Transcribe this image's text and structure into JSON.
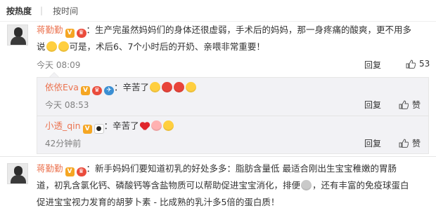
{
  "sort": {
    "hot": "按热度",
    "time": "按时间",
    "divider": "|"
  },
  "comments": [
    {
      "username": "蒋勤勤",
      "text_part1": "：生产完虽然妈妈们的身体还很虚弱，手术后的妈妈，那一身疼痛的酸爽，更不用多",
      "text_part2a": "说",
      "text_part2b": "可是，术后6、7个小时后的开奶、亲喂非常重要！",
      "time": "今天 08:09",
      "reply_label": "回复",
      "like_count": "53"
    },
    {
      "username": "蒋勤勤",
      "text_part1": "：新手妈妈们要知道初乳的好处多多：脂肪含量低 最适合刚出生宝宝稚嫩的胃肠",
      "text_part2": "道，初乳含氯化钙、磷酸钙等含盐物质可以帮助促进宝宝消化，排便",
      "text_part2b": "，还有丰富的免疫球蛋白",
      "text_part3": "促进宝宝视力发育的胡萝卜素 - 比成熟的乳汁多5倍的蛋白质！"
    }
  ],
  "replies": [
    {
      "username": "依依Eva",
      "text": "：辛苦了",
      "time": "今天 08:53",
      "reply_label": "回复",
      "like_label": "赞"
    },
    {
      "username": "小透_qin",
      "text": "：辛苦了",
      "time": "42分钟前",
      "reply_label": "回复",
      "like_label": "赞"
    }
  ],
  "icons": {
    "badge_v": "V",
    "colors": {
      "username": "#eb7350",
      "meta": "#808080",
      "reply_bg": "#f2f2f5"
    }
  }
}
